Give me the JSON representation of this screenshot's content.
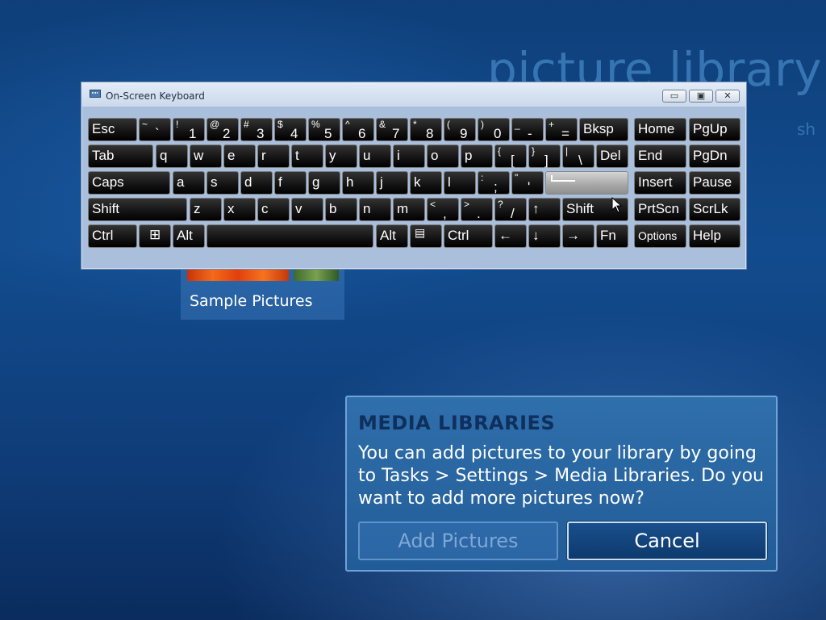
{
  "background": {
    "library_title": "picture library",
    "library_subtitle": "sh"
  },
  "tile": {
    "label": "Sample Pictures"
  },
  "osk": {
    "title": "On-Screen Keyboard",
    "controls": {
      "minimize": "▭",
      "restore": "▣",
      "close": "✕"
    },
    "rows": [
      [
        {
          "label": "Esc"
        },
        {
          "sup": "~",
          "sub": "`"
        },
        {
          "sup": "!",
          "sub": "1"
        },
        {
          "sup": "@",
          "sub": "2"
        },
        {
          "sup": "#",
          "sub": "3"
        },
        {
          "sup": "$",
          "sub": "4"
        },
        {
          "sup": "%",
          "sub": "5"
        },
        {
          "sup": "^",
          "sub": "6"
        },
        {
          "sup": "&",
          "sub": "7"
        },
        {
          "sup": "*",
          "sub": "8"
        },
        {
          "sup": "(",
          "sub": "9"
        },
        {
          "sup": ")",
          "sub": "0"
        },
        {
          "sup": "_",
          "sub": "-"
        },
        {
          "sup": "+",
          "sub": "="
        },
        {
          "label": "Bksp"
        },
        {
          "label": "Home"
        },
        {
          "label": "PgUp"
        }
      ],
      [
        {
          "label": "Tab"
        },
        {
          "label": "q"
        },
        {
          "label": "w"
        },
        {
          "label": "e"
        },
        {
          "label": "r"
        },
        {
          "label": "t"
        },
        {
          "label": "y"
        },
        {
          "label": "u"
        },
        {
          "label": "i"
        },
        {
          "label": "o"
        },
        {
          "label": "p"
        },
        {
          "sup": "{",
          "sub": "["
        },
        {
          "sup": "}",
          "sub": "]"
        },
        {
          "sup": "|",
          "sub": "\\"
        },
        {
          "label": "Del"
        },
        {
          "label": "End"
        },
        {
          "label": "PgDn"
        }
      ],
      [
        {
          "label": "Caps"
        },
        {
          "label": "a"
        },
        {
          "label": "s"
        },
        {
          "label": "d"
        },
        {
          "label": "f"
        },
        {
          "label": "g"
        },
        {
          "label": "h"
        },
        {
          "label": "j"
        },
        {
          "label": "k"
        },
        {
          "label": "l"
        },
        {
          "sup": ":",
          "sub": ";"
        },
        {
          "sup": "\"",
          "sub": "'"
        },
        {
          "label": "",
          "icon": "enter-arrow-icon"
        },
        {
          "label": "Insert"
        },
        {
          "label": "Pause"
        }
      ],
      [
        {
          "label": "Shift"
        },
        {
          "label": "z"
        },
        {
          "label": "x"
        },
        {
          "label": "c"
        },
        {
          "label": "v"
        },
        {
          "label": "b"
        },
        {
          "label": "n"
        },
        {
          "label": "m"
        },
        {
          "sup": "<",
          "sub": ","
        },
        {
          "sup": ">",
          "sub": "."
        },
        {
          "sup": "?",
          "sub": "/"
        },
        {
          "label": "↑"
        },
        {
          "label": "Shift"
        },
        {
          "label": "PrtScn"
        },
        {
          "label": "ScrLk"
        }
      ],
      [
        {
          "label": "Ctrl"
        },
        {
          "label": "",
          "icon": "windows-logo-icon"
        },
        {
          "label": "Alt"
        },
        {
          "label": ""
        },
        {
          "label": "Alt"
        },
        {
          "label": "",
          "icon": "menu-key-icon"
        },
        {
          "label": "Ctrl"
        },
        {
          "label": "←"
        },
        {
          "label": "↓"
        },
        {
          "label": "→"
        },
        {
          "label": "Fn"
        },
        {
          "label": "Options"
        },
        {
          "label": "Help"
        }
      ]
    ]
  },
  "dialog": {
    "title": "MEDIA LIBRARIES",
    "body": "You can add pictures to your library by going to Tasks > Settings > Media Libraries. Do you want to add more pictures now?",
    "add_button": "Add Pictures",
    "cancel_button": "Cancel"
  }
}
